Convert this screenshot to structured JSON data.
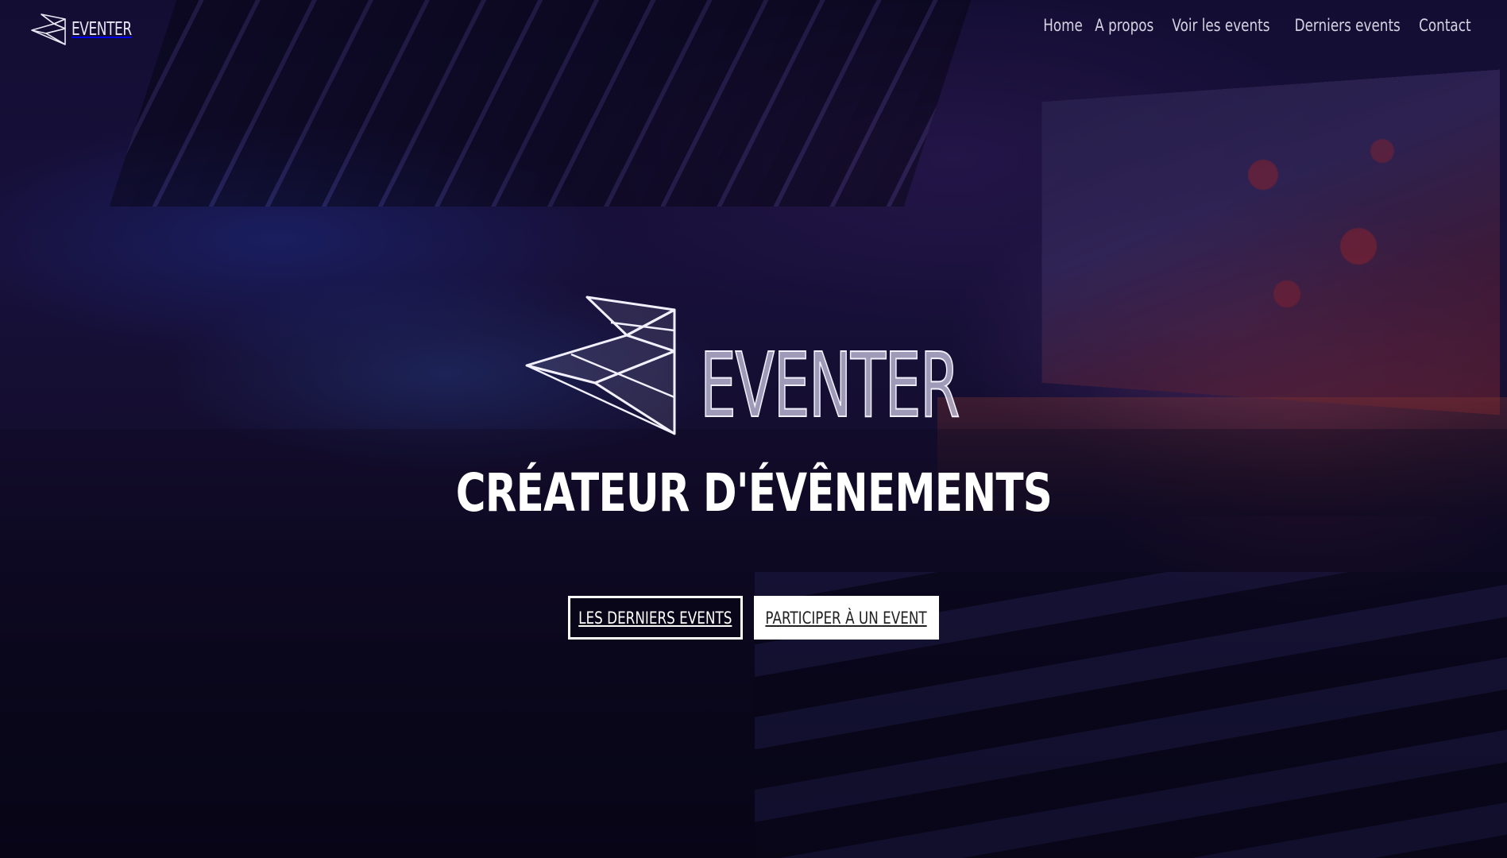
{
  "navbar": {
    "brand": "EVENTER",
    "brand_icon": "eventer-logo-icon",
    "links": [
      "Home",
      "A propos",
      "Voir les events",
      "Derniers events",
      "Contact"
    ]
  },
  "hero": {
    "logo_text": "EVENTER",
    "logo_icon": "eventer-logo-mark",
    "title": "CRÉATEUR D'ÉVÊNEMENTS",
    "primary_button": "LES DERNIERS EVENTS",
    "secondary_button": "PARTICIPER À UN EVENT"
  },
  "colors": {
    "text": "#ffffff",
    "overlay": "#0a061e",
    "button_solid_bg": "#ffffff",
    "button_solid_text": "#222222"
  }
}
